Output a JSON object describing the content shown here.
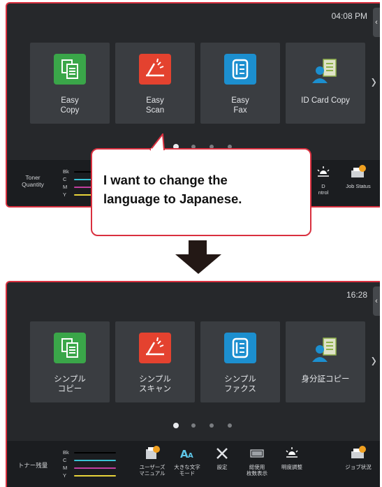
{
  "screens": [
    {
      "clock": "04:08 PM",
      "tiles": [
        {
          "label": "Easy\nCopy",
          "icon": "copy-icon"
        },
        {
          "label": "Easy\nScan",
          "icon": "scan-icon"
        },
        {
          "label": "Easy\nFax",
          "icon": "fax-icon"
        },
        {
          "label": "ID Card Copy",
          "icon": "id-card-icon"
        }
      ],
      "toner": {
        "label": "Toner\nQuantity",
        "rows": [
          "Bk",
          "C",
          "M",
          "Y"
        ]
      },
      "actions": [
        {
          "label": "",
          "icon": "user-manual-icon"
        },
        {
          "label": "",
          "icon": "large-text-icon"
        },
        {
          "label": "",
          "icon": "settings-icon"
        },
        {
          "label": "",
          "icon": "counter-icon"
        },
        {
          "label": "D\nntrol",
          "icon": "brightness-icon"
        },
        {
          "label": "Job Status",
          "icon": "job-status-icon"
        }
      ]
    },
    {
      "clock": "16:28",
      "tiles": [
        {
          "label": "シンプル\nコピー",
          "icon": "copy-icon"
        },
        {
          "label": "シンプル\nスキャン",
          "icon": "scan-icon"
        },
        {
          "label": "シンプル\nファクス",
          "icon": "fax-icon"
        },
        {
          "label": "身分証コピー",
          "icon": "id-card-icon"
        }
      ],
      "toner": {
        "label": "トナー残量",
        "rows": [
          "Bk",
          "C",
          "M",
          "Y"
        ]
      },
      "actions": [
        {
          "label": "ユーザーズ\nマニュアル",
          "icon": "user-manual-icon"
        },
        {
          "label": "大きな文字\nモード",
          "icon": "large-text-icon"
        },
        {
          "label": "設定",
          "icon": "settings-icon"
        },
        {
          "label": "総使用\n枚数表示",
          "icon": "counter-icon"
        },
        {
          "label": "明度調整",
          "icon": "brightness-icon"
        },
        {
          "label": "ジョブ状況",
          "icon": "job-status-icon"
        }
      ]
    }
  ],
  "callout": {
    "text": "I want to change the\nlanguage to Japanese."
  },
  "colors": {
    "accent_border": "#d9303f",
    "screen_bg": "#26282b",
    "tile_bg": "#3a3d41",
    "copy": "#3aa649",
    "scan": "#e4422f",
    "fax": "#1c8fcf",
    "toner_bk": "#000000",
    "toner_c": "#38c3d6",
    "toner_m": "#c13fa0",
    "toner_y": "#e8d33a"
  }
}
